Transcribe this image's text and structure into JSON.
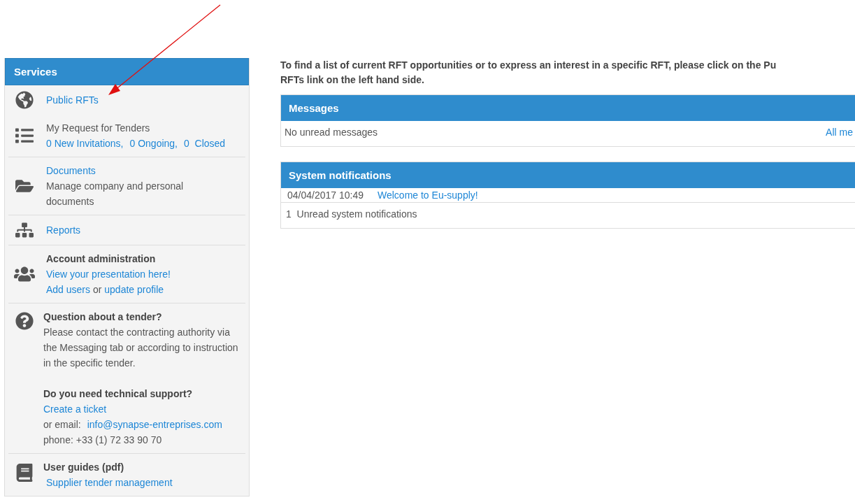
{
  "sidebar": {
    "title": "Services",
    "items": [
      {
        "kind": "public",
        "link": "Public RFTs"
      },
      {
        "kind": "tenders",
        "title": "My Request for Tenders",
        "links": [
          "0 New Invitations,",
          "0 Ongoing,",
          "0  Closed"
        ]
      },
      {
        "kind": "documents",
        "link": "Documents",
        "text": "Manage company and personal documents"
      },
      {
        "kind": "reports",
        "link": "Reports"
      },
      {
        "kind": "account",
        "heading": "Account administration",
        "link": "View your presentation here!",
        "line": [
          {
            "text": "Add users",
            "link": true
          },
          {
            "text": "or",
            "link": false
          },
          {
            "text": "update profile",
            "link": true
          }
        ]
      },
      {
        "kind": "help",
        "heading": "Question about a tender?",
        "text": "Please contact the contracting authority via the Messaging tab or according to instruction in the specific tender.",
        "heading2": "Do you need technical support?",
        "link": "Create a ticket",
        "email_label": "or email:",
        "email": "info@synapse-entreprises.com",
        "phone": "phone: +33 (1) 72 33 90 70"
      },
      {
        "kind": "guides",
        "heading": "User guides (pdf)",
        "link": "Supplier tender management"
      }
    ]
  },
  "intro": [
    "To find a list of current RFT opportunities or to express an interest in a specific RFT, please click on the Pu",
    "RFTs link on the left hand side."
  ],
  "messages": {
    "title": "Messages",
    "text": "No unread messages",
    "link": "All me"
  },
  "notifications": {
    "title": "System notifications",
    "items": [
      {
        "time": "04/04/2017 10:49",
        "link": "Welcome to Eu-supply!"
      }
    ],
    "summary": "1  Unread system notifications"
  }
}
